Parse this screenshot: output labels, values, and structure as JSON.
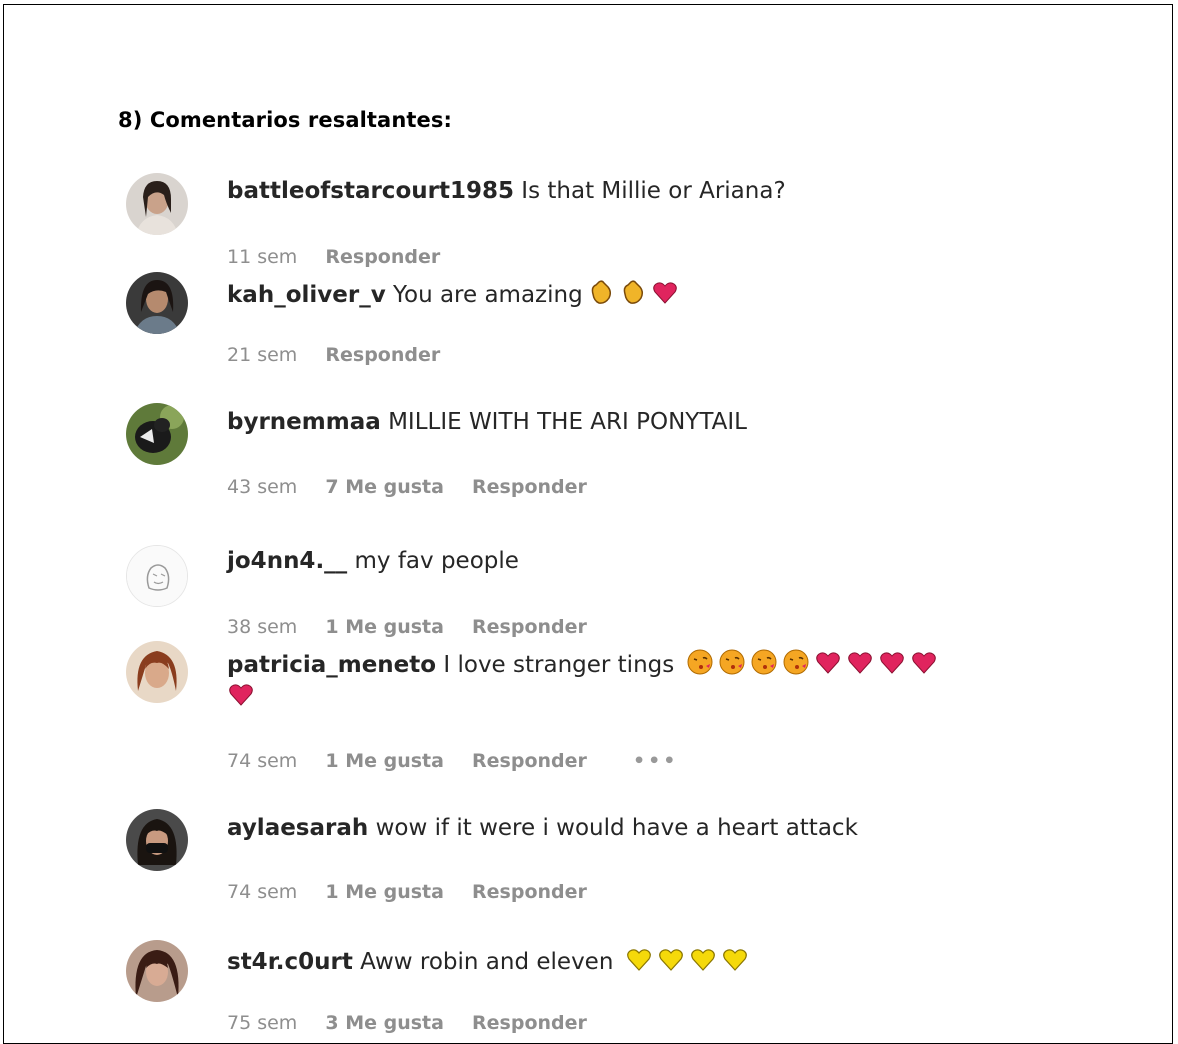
{
  "heading": "8) Comentarios resaltantes:",
  "comments": [
    {
      "user": "battleofstarcourt1985",
      "text": "Is that Millie or Ariana?",
      "time": "11 sem",
      "reply": "Responder"
    },
    {
      "user": "kah_oliver_v",
      "text": "You are amazing",
      "emojis": [
        "clap",
        "clap",
        "heart"
      ],
      "time": "21 sem",
      "reply": "Responder"
    },
    {
      "user": "byrnemmaa",
      "text": "MILLIE WITH THE ARI PONYTAIL",
      "time": "43 sem",
      "likes": "7 Me gusta",
      "reply": "Responder"
    },
    {
      "user": "jo4nn4.__",
      "text": "my fav people",
      "time": "38 sem",
      "likes": "1 Me gusta",
      "reply": "Responder"
    },
    {
      "user": "patricia_meneto",
      "text": "I love stranger tings",
      "emojis": [
        "kiss",
        "kiss",
        "kiss",
        "kiss",
        "heart",
        "heart",
        "heart",
        "heart",
        "heart"
      ],
      "time": "74 sem",
      "likes": "1 Me gusta",
      "reply": "Responder",
      "more": "•••"
    },
    {
      "user": "aylaesarah",
      "text": "wow if it were i would have a heart attack",
      "time": "74 sem",
      "likes": "1 Me gusta",
      "reply": "Responder"
    },
    {
      "user": "st4r.c0urt",
      "text": "Aww robin and eleven",
      "emojis": [
        "yellow-heart",
        "yellow-heart",
        "yellow-heart",
        "yellow-heart"
      ],
      "time": "75 sem",
      "likes": "3 Me gusta",
      "reply": "Responder"
    }
  ],
  "colors": {
    "username": "#262626",
    "meta": "#8e8e8e",
    "heart": "#e0245e",
    "yellow_heart": "#f5d90a",
    "clap": "#f0b429",
    "kiss": "#f5a623"
  }
}
